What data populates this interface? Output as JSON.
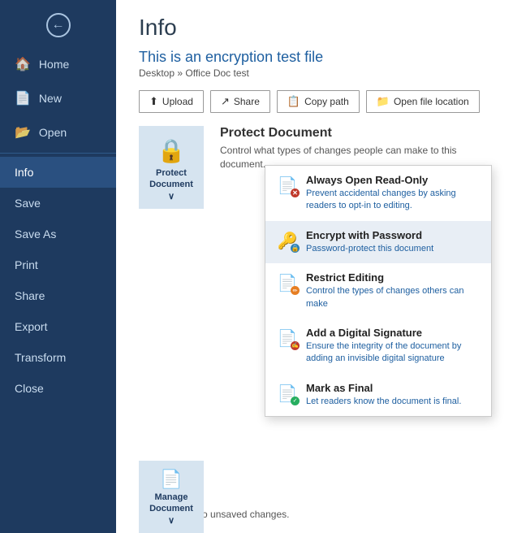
{
  "sidebar": {
    "back_icon": "←",
    "items": [
      {
        "id": "home",
        "label": "Home",
        "icon": "🏠",
        "active": false
      },
      {
        "id": "new",
        "label": "New",
        "icon": "📄",
        "active": false
      },
      {
        "id": "open",
        "label": "Open",
        "icon": "📂",
        "active": false
      },
      {
        "id": "info",
        "label": "Info",
        "icon": "",
        "active": true
      },
      {
        "id": "save",
        "label": "Save",
        "icon": "",
        "active": false
      },
      {
        "id": "save-as",
        "label": "Save As",
        "icon": "",
        "active": false
      },
      {
        "id": "print",
        "label": "Print",
        "icon": "",
        "active": false
      },
      {
        "id": "share",
        "label": "Share",
        "icon": "",
        "active": false
      },
      {
        "id": "export",
        "label": "Export",
        "icon": "",
        "active": false
      },
      {
        "id": "transform",
        "label": "Transform",
        "icon": "",
        "active": false
      },
      {
        "id": "close",
        "label": "Close",
        "icon": "",
        "active": false
      }
    ]
  },
  "main": {
    "title": "Info",
    "file_title": "This is an encryption test file",
    "breadcrumb": "Desktop » Office Doc test",
    "buttons": [
      {
        "id": "upload",
        "label": "Upload",
        "icon": "⬆"
      },
      {
        "id": "share",
        "label": "Share",
        "icon": "↗"
      },
      {
        "id": "copy-path",
        "label": "Copy path",
        "icon": "📋"
      },
      {
        "id": "open-location",
        "label": "Open file location",
        "icon": "📁"
      }
    ],
    "protect_document": {
      "title": "Protect Document",
      "label": "Protect\nDocument ∨",
      "description": "Control what types of changes people can make to this document."
    },
    "dropdown_items": [
      {
        "id": "always-open-readonly",
        "title": "Always Open Read-Only",
        "description": "Prevent accidental changes by asking readers to opt-in to editing.",
        "badge_color": "red",
        "selected": false
      },
      {
        "id": "encrypt-with-password",
        "title": "Encrypt with Password",
        "description": "Password-protect this document",
        "badge_color": "blue",
        "selected": true
      },
      {
        "id": "restrict-editing",
        "title": "Restrict Editing",
        "description": "Control the types of changes others can make",
        "badge_color": "yellow",
        "selected": false
      },
      {
        "id": "add-digital-signature",
        "title": "Add a Digital Signature",
        "description": "Ensure the integrity of the document by adding an invisible digital signature",
        "badge_color": "red",
        "selected": false
      },
      {
        "id": "mark-as-final",
        "title": "Mark as Final",
        "description": "Let readers know the document is final.",
        "badge_color": "green",
        "selected": false
      }
    ],
    "manage_document": {
      "label": "Manage\nDocument ∨",
      "bottom_text": "There are no unsaved changes."
    }
  }
}
